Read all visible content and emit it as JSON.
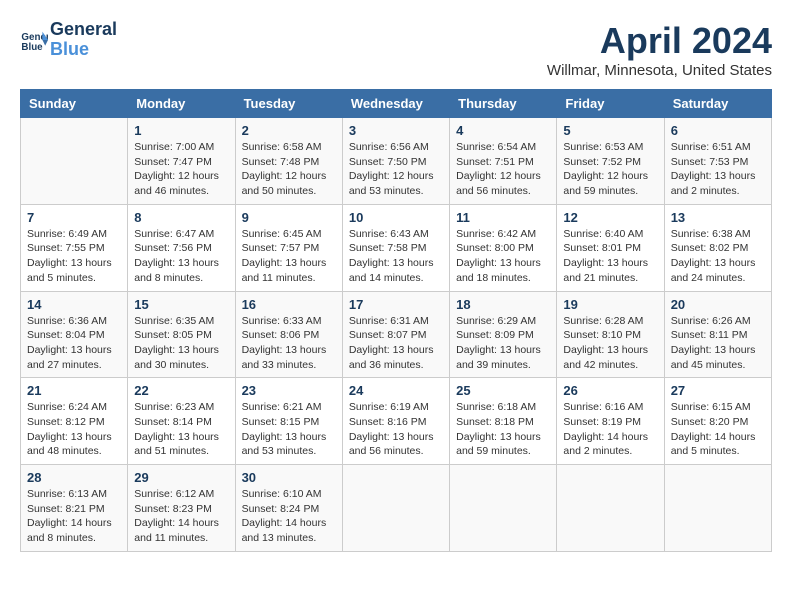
{
  "header": {
    "logo_line1": "General",
    "logo_line2": "Blue",
    "title": "April 2024",
    "location": "Willmar, Minnesota, United States"
  },
  "weekdays": [
    "Sunday",
    "Monday",
    "Tuesday",
    "Wednesday",
    "Thursday",
    "Friday",
    "Saturday"
  ],
  "weeks": [
    [
      {
        "day": "",
        "sunrise": "",
        "sunset": "",
        "daylight": ""
      },
      {
        "day": "1",
        "sunrise": "Sunrise: 7:00 AM",
        "sunset": "Sunset: 7:47 PM",
        "daylight": "Daylight: 12 hours and 46 minutes."
      },
      {
        "day": "2",
        "sunrise": "Sunrise: 6:58 AM",
        "sunset": "Sunset: 7:48 PM",
        "daylight": "Daylight: 12 hours and 50 minutes."
      },
      {
        "day": "3",
        "sunrise": "Sunrise: 6:56 AM",
        "sunset": "Sunset: 7:50 PM",
        "daylight": "Daylight: 12 hours and 53 minutes."
      },
      {
        "day": "4",
        "sunrise": "Sunrise: 6:54 AM",
        "sunset": "Sunset: 7:51 PM",
        "daylight": "Daylight: 12 hours and 56 minutes."
      },
      {
        "day": "5",
        "sunrise": "Sunrise: 6:53 AM",
        "sunset": "Sunset: 7:52 PM",
        "daylight": "Daylight: 12 hours and 59 minutes."
      },
      {
        "day": "6",
        "sunrise": "Sunrise: 6:51 AM",
        "sunset": "Sunset: 7:53 PM",
        "daylight": "Daylight: 13 hours and 2 minutes."
      }
    ],
    [
      {
        "day": "7",
        "sunrise": "Sunrise: 6:49 AM",
        "sunset": "Sunset: 7:55 PM",
        "daylight": "Daylight: 13 hours and 5 minutes."
      },
      {
        "day": "8",
        "sunrise": "Sunrise: 6:47 AM",
        "sunset": "Sunset: 7:56 PM",
        "daylight": "Daylight: 13 hours and 8 minutes."
      },
      {
        "day": "9",
        "sunrise": "Sunrise: 6:45 AM",
        "sunset": "Sunset: 7:57 PM",
        "daylight": "Daylight: 13 hours and 11 minutes."
      },
      {
        "day": "10",
        "sunrise": "Sunrise: 6:43 AM",
        "sunset": "Sunset: 7:58 PM",
        "daylight": "Daylight: 13 hours and 14 minutes."
      },
      {
        "day": "11",
        "sunrise": "Sunrise: 6:42 AM",
        "sunset": "Sunset: 8:00 PM",
        "daylight": "Daylight: 13 hours and 18 minutes."
      },
      {
        "day": "12",
        "sunrise": "Sunrise: 6:40 AM",
        "sunset": "Sunset: 8:01 PM",
        "daylight": "Daylight: 13 hours and 21 minutes."
      },
      {
        "day": "13",
        "sunrise": "Sunrise: 6:38 AM",
        "sunset": "Sunset: 8:02 PM",
        "daylight": "Daylight: 13 hours and 24 minutes."
      }
    ],
    [
      {
        "day": "14",
        "sunrise": "Sunrise: 6:36 AM",
        "sunset": "Sunset: 8:04 PM",
        "daylight": "Daylight: 13 hours and 27 minutes."
      },
      {
        "day": "15",
        "sunrise": "Sunrise: 6:35 AM",
        "sunset": "Sunset: 8:05 PM",
        "daylight": "Daylight: 13 hours and 30 minutes."
      },
      {
        "day": "16",
        "sunrise": "Sunrise: 6:33 AM",
        "sunset": "Sunset: 8:06 PM",
        "daylight": "Daylight: 13 hours and 33 minutes."
      },
      {
        "day": "17",
        "sunrise": "Sunrise: 6:31 AM",
        "sunset": "Sunset: 8:07 PM",
        "daylight": "Daylight: 13 hours and 36 minutes."
      },
      {
        "day": "18",
        "sunrise": "Sunrise: 6:29 AM",
        "sunset": "Sunset: 8:09 PM",
        "daylight": "Daylight: 13 hours and 39 minutes."
      },
      {
        "day": "19",
        "sunrise": "Sunrise: 6:28 AM",
        "sunset": "Sunset: 8:10 PM",
        "daylight": "Daylight: 13 hours and 42 minutes."
      },
      {
        "day": "20",
        "sunrise": "Sunrise: 6:26 AM",
        "sunset": "Sunset: 8:11 PM",
        "daylight": "Daylight: 13 hours and 45 minutes."
      }
    ],
    [
      {
        "day": "21",
        "sunrise": "Sunrise: 6:24 AM",
        "sunset": "Sunset: 8:12 PM",
        "daylight": "Daylight: 13 hours and 48 minutes."
      },
      {
        "day": "22",
        "sunrise": "Sunrise: 6:23 AM",
        "sunset": "Sunset: 8:14 PM",
        "daylight": "Daylight: 13 hours and 51 minutes."
      },
      {
        "day": "23",
        "sunrise": "Sunrise: 6:21 AM",
        "sunset": "Sunset: 8:15 PM",
        "daylight": "Daylight: 13 hours and 53 minutes."
      },
      {
        "day": "24",
        "sunrise": "Sunrise: 6:19 AM",
        "sunset": "Sunset: 8:16 PM",
        "daylight": "Daylight: 13 hours and 56 minutes."
      },
      {
        "day": "25",
        "sunrise": "Sunrise: 6:18 AM",
        "sunset": "Sunset: 8:18 PM",
        "daylight": "Daylight: 13 hours and 59 minutes."
      },
      {
        "day": "26",
        "sunrise": "Sunrise: 6:16 AM",
        "sunset": "Sunset: 8:19 PM",
        "daylight": "Daylight: 14 hours and 2 minutes."
      },
      {
        "day": "27",
        "sunrise": "Sunrise: 6:15 AM",
        "sunset": "Sunset: 8:20 PM",
        "daylight": "Daylight: 14 hours and 5 minutes."
      }
    ],
    [
      {
        "day": "28",
        "sunrise": "Sunrise: 6:13 AM",
        "sunset": "Sunset: 8:21 PM",
        "daylight": "Daylight: 14 hours and 8 minutes."
      },
      {
        "day": "29",
        "sunrise": "Sunrise: 6:12 AM",
        "sunset": "Sunset: 8:23 PM",
        "daylight": "Daylight: 14 hours and 11 minutes."
      },
      {
        "day": "30",
        "sunrise": "Sunrise: 6:10 AM",
        "sunset": "Sunset: 8:24 PM",
        "daylight": "Daylight: 14 hours and 13 minutes."
      },
      {
        "day": "",
        "sunrise": "",
        "sunset": "",
        "daylight": ""
      },
      {
        "day": "",
        "sunrise": "",
        "sunset": "",
        "daylight": ""
      },
      {
        "day": "",
        "sunrise": "",
        "sunset": "",
        "daylight": ""
      },
      {
        "day": "",
        "sunrise": "",
        "sunset": "",
        "daylight": ""
      }
    ]
  ]
}
